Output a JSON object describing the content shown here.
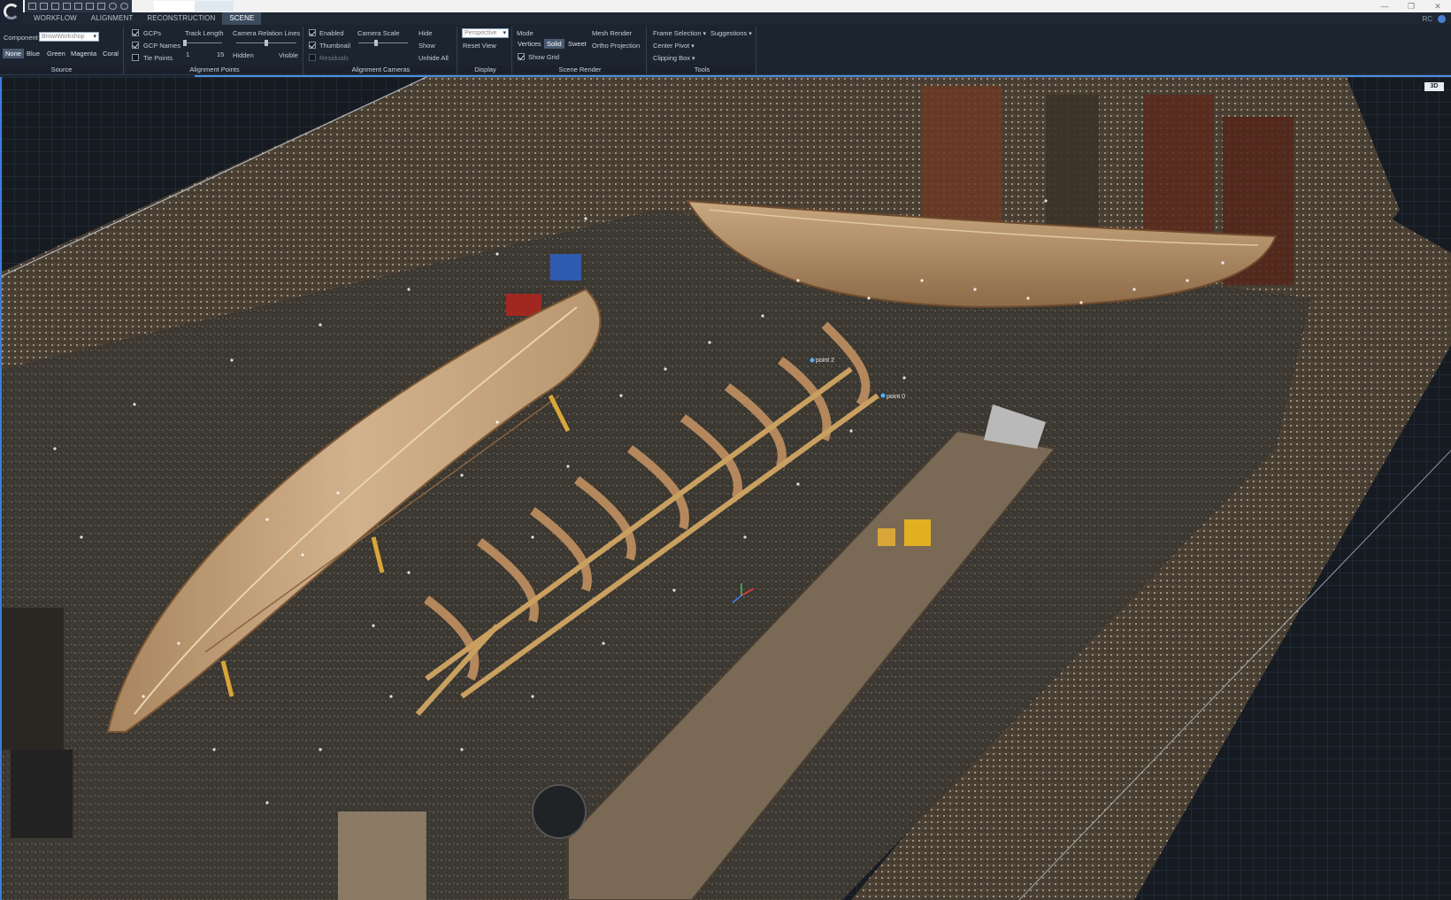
{
  "menu": {
    "tabs": [
      {
        "label": "WORKFLOW",
        "active": false
      },
      {
        "label": "ALIGNMENT",
        "active": false
      },
      {
        "label": "RECONSTRUCTION",
        "active": false
      },
      {
        "label": "SCENE",
        "active": true
      }
    ],
    "right_text": "RC"
  },
  "source": {
    "title": "Source",
    "component_label": "Component",
    "component_value": "BriswWorkshop",
    "colors": [
      "None",
      "Blue",
      "Green",
      "Magenta",
      "Coral"
    ],
    "selected_color": "None"
  },
  "alignment_points": {
    "title": "Alignment Points",
    "gcps": "GCPs",
    "gcp_names": "GCP Names",
    "tie_points": "Tie Points",
    "track_length": "Track Length",
    "track_min": "1",
    "track_max": "15",
    "camera_relation_lines": "Camera Relation Lines",
    "hidden": "Hidden",
    "visible": "Visible",
    "track_level": 0.0,
    "relation_level": 0.5
  },
  "alignment_cameras": {
    "title": "Alignment Cameras",
    "enabled": "Enabled",
    "thumbnail": "Thumbnail",
    "residuals": "Residuals",
    "camera_scale": "Camera Scale",
    "scale_level": 0.35,
    "hide": "Hide",
    "show": "Show",
    "unhide_all": "Unhide All"
  },
  "display": {
    "title": "Display",
    "projection_value": "Perspective",
    "reset_view": "Reset View"
  },
  "scene_render": {
    "title": "Scene Render",
    "mode_label": "Mode",
    "modes": [
      "Vertices",
      "Solid",
      "Sweet"
    ],
    "active_mode": "Solid",
    "show_grid": "Show Grid",
    "mesh_render": "Mesh Render",
    "ortho_projection": "Ortho Projection"
  },
  "tools": {
    "title": "Tools",
    "frame_selection": "Frame Selection",
    "suggestions": "Suggestions",
    "center_pivot": "Center Pivot",
    "clipping_box": "Clipping Box"
  },
  "viewport": {
    "view_badge": "3D",
    "point_labels": [
      "point 2",
      "point 0"
    ]
  },
  "colors": {
    "accent": "#4a8fe0",
    "ribbon_bg": "#1c2430",
    "floor": "#47423a",
    "wood": "#c49a6e"
  }
}
